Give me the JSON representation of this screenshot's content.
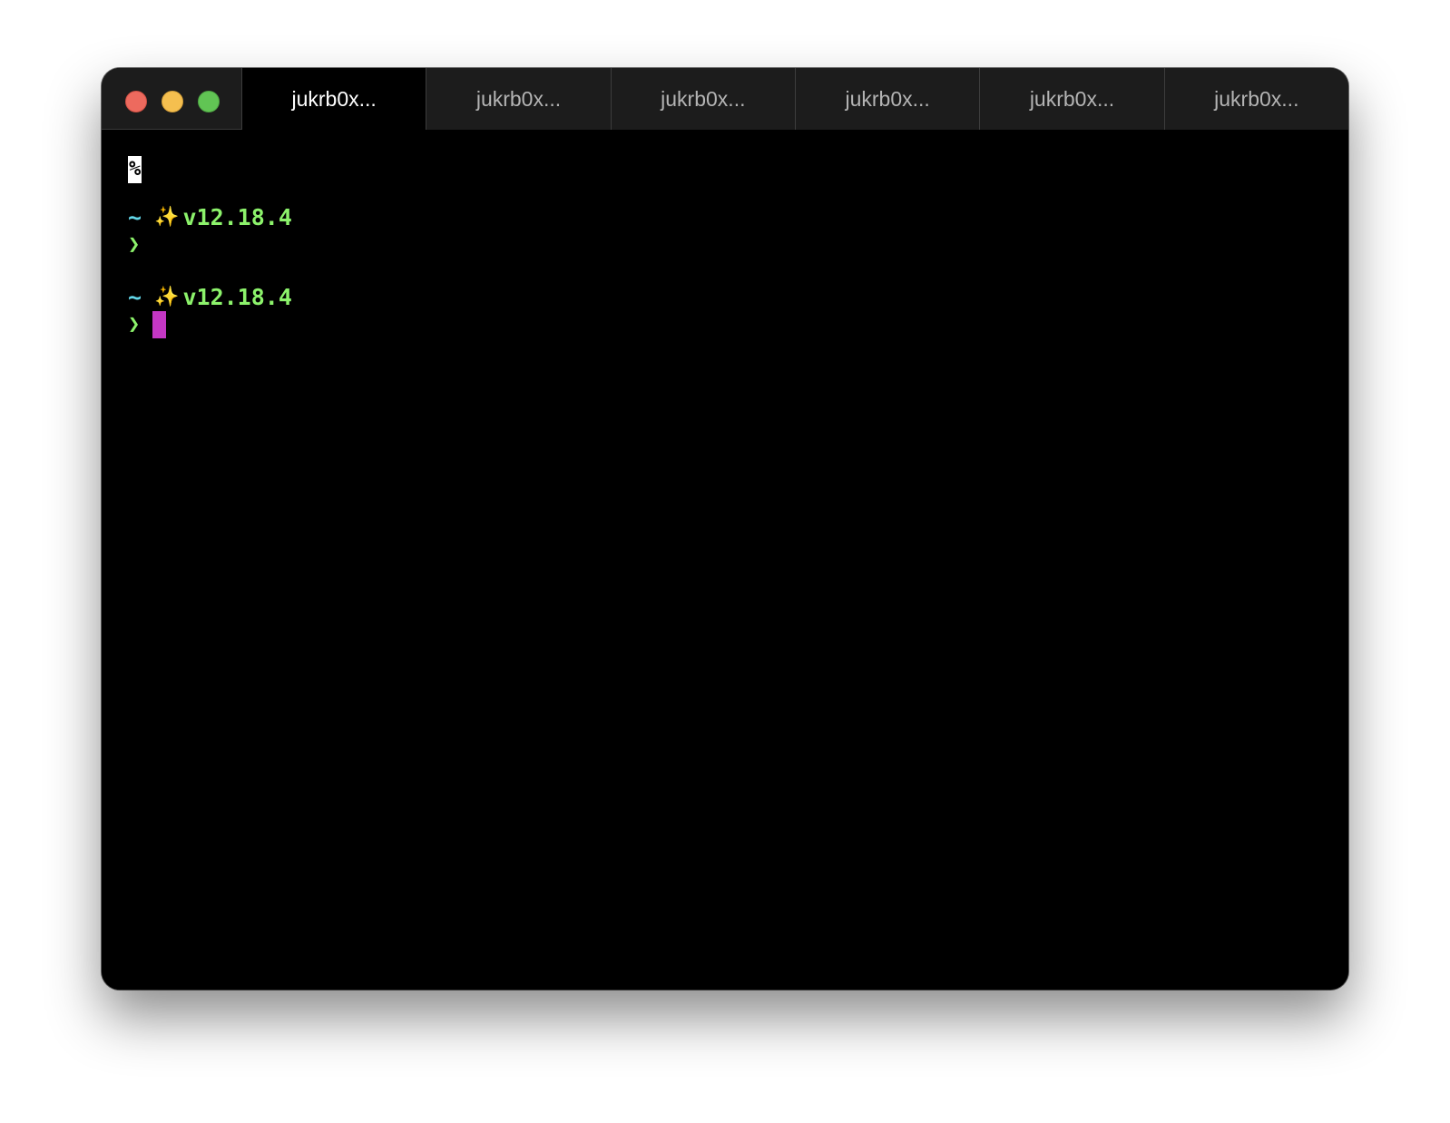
{
  "window": {
    "tabs": [
      {
        "label": "jukrb0x...",
        "active": true
      },
      {
        "label": "jukrb0x...",
        "active": false
      },
      {
        "label": "jukrb0x...",
        "active": false
      },
      {
        "label": "jukrb0x...",
        "active": false
      },
      {
        "label": "jukrb0x...",
        "active": false
      },
      {
        "label": "jukrb0x...",
        "active": false
      }
    ]
  },
  "terminal": {
    "end_of_line_marker": "%",
    "prompts": [
      {
        "dir": "~",
        "icon": "✨",
        "node_version": "v12.18.4",
        "symbol": "❯"
      },
      {
        "dir": "~",
        "icon": "✨",
        "node_version": "v12.18.4",
        "symbol": "❯"
      }
    ]
  },
  "colors": {
    "background": "#000000",
    "dir": "#62d6e8",
    "version": "#8cf26b",
    "cursor": "#c437c4"
  }
}
